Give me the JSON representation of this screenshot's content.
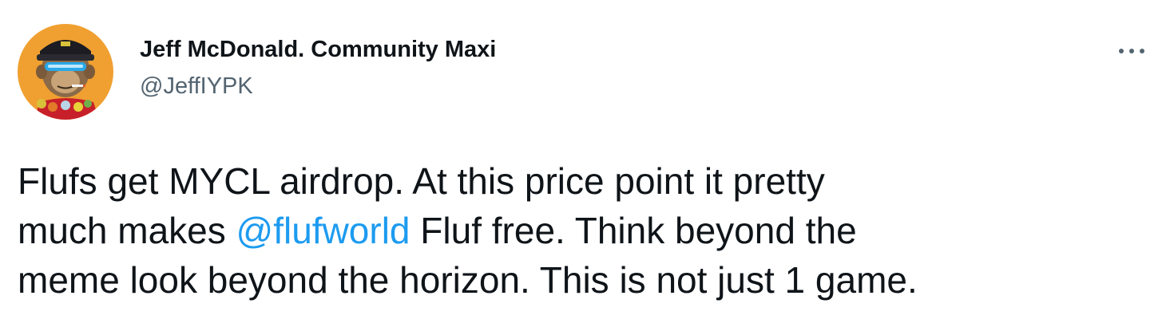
{
  "author": {
    "display_name": "Jeff McDonald. Community Maxi",
    "handle": "@JeffIYPK"
  },
  "tweet": {
    "line1": "Flufs get MYCL airdrop. At this price point it pretty",
    "line2_before": "much makes ",
    "mention": "@flufworld",
    "line2_after": " Fluf free. Think beyond the",
    "line3": "meme look beyond the horizon. This is not just 1 game."
  },
  "icons": {
    "more": "more-horizontal-icon",
    "avatar": "ape-avatar-image"
  },
  "colors": {
    "text": "#0f1419",
    "secondary": "#536471",
    "link": "#1d9bf0",
    "avatar_bg": "#f0a030"
  }
}
